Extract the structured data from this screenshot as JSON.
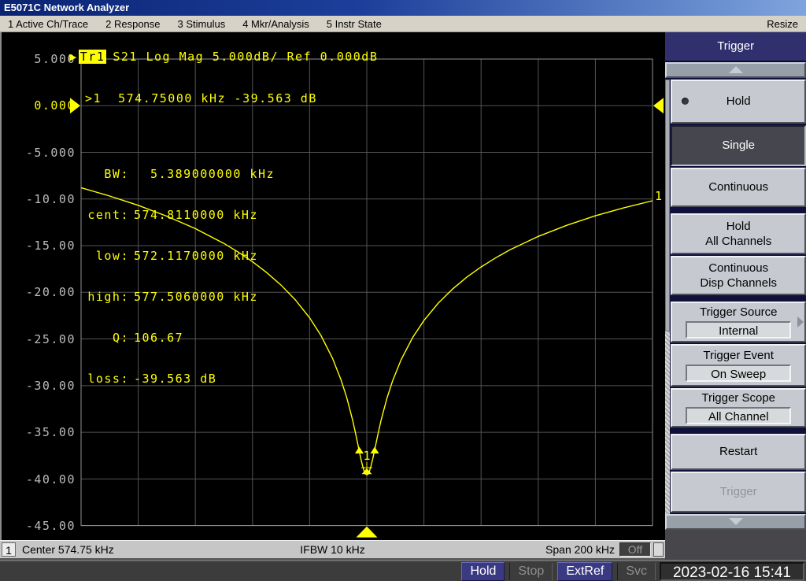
{
  "title_bar": {
    "title": "E5071C Network Analyzer"
  },
  "menu_bar": {
    "items": [
      "1 Active Ch/Trace",
      "2 Response",
      "3 Stimulus",
      "4 Mkr/Analysis",
      "5 Instr State"
    ],
    "resize": "Resize"
  },
  "trace_header": {
    "arrow": "▶",
    "trace": "Tr1",
    "text": "S21 Log Mag 5.000dB/ Ref 0.000dB"
  },
  "marker_readout": {
    "line1": ">1  574.75000 kHz -39.563 dB",
    "rows": [
      {
        "label": "BW:",
        "value": "  5.389000000 kHz"
      },
      {
        "label": "cent:",
        "value": "574.8110000 kHz"
      },
      {
        "label": "low:",
        "value": "572.1170000 kHz"
      },
      {
        "label": "high:",
        "value": "577.5060000 kHz"
      },
      {
        "label": "Q:",
        "value": "106.67"
      },
      {
        "label": "loss:",
        "value": "-39.563 dB"
      }
    ]
  },
  "axis": {
    "y_labels": [
      "5.000",
      "0.000",
      "-5.000",
      "-10.00",
      "-15.00",
      "-20.00",
      "-25.00",
      "-30.00",
      "-35.00",
      "-40.00",
      "-45.00"
    ]
  },
  "chart_data": {
    "type": "line",
    "title": "Tr1 S21 Log Mag 5.000dB/ Ref 0.000dB",
    "ylabel": "dB",
    "ylim": [
      -45,
      5
    ],
    "scale_db_per_div": 5,
    "ref_level_db": 0,
    "center_khz": 574.75,
    "x_span_khz": 200,
    "x_range_khz": [
      474.75,
      674.75
    ],
    "grid": true,
    "series": [
      {
        "name": "Tr1 S21",
        "trace_number": "1",
        "color": "#ffff00",
        "points": [
          [
            -100,
            -8.79
          ],
          [
            -90,
            -9.68
          ],
          [
            -80,
            -10.68
          ],
          [
            -70,
            -11.84
          ],
          [
            -60,
            -13.17
          ],
          [
            -50,
            -14.76
          ],
          [
            -45,
            -15.69
          ],
          [
            -40,
            -16.72
          ],
          [
            -35,
            -17.89
          ],
          [
            -30,
            -19.23
          ],
          [
            -25,
            -20.82
          ],
          [
            -20,
            -22.74
          ],
          [
            -16,
            -24.65
          ],
          [
            -12,
            -27.06
          ],
          [
            -9,
            -29.39
          ],
          [
            -7,
            -31.31
          ],
          [
            -5,
            -33.67
          ],
          [
            -4,
            -35.02
          ],
          [
            -3,
            -36.48
          ],
          [
            -2.5,
            -37.21
          ],
          [
            -2,
            -37.93
          ],
          [
            -1.5,
            -38.57
          ],
          [
            -1,
            -39.1
          ],
          [
            -0.5,
            -39.46
          ],
          [
            0,
            -39.563
          ],
          [
            0.5,
            -39.47
          ],
          [
            1,
            -39.12
          ],
          [
            1.5,
            -38.59
          ],
          [
            2,
            -37.95
          ],
          [
            2.5,
            -37.25
          ],
          [
            3,
            -36.52
          ],
          [
            4,
            -35.08
          ],
          [
            5,
            -33.74
          ],
          [
            7,
            -31.41
          ],
          [
            9,
            -29.51
          ],
          [
            12,
            -27.22
          ],
          [
            16,
            -24.87
          ],
          [
            20,
            -23.02
          ],
          [
            25,
            -21.16
          ],
          [
            30,
            -19.65
          ],
          [
            35,
            -18.38
          ],
          [
            40,
            -17.28
          ],
          [
            45,
            -16.32
          ],
          [
            50,
            -15.46
          ],
          [
            60,
            -14.01
          ],
          [
            70,
            -12.82
          ],
          [
            80,
            -11.8
          ],
          [
            90,
            -10.94
          ],
          [
            100,
            -10.19
          ]
        ]
      }
    ],
    "markers": {
      "marker1_number": "1",
      "marker1_freq_khz": 574.75,
      "marker1_offset_khz": 0,
      "marker1_db": -39.563,
      "bandwidth_khz": 5.389,
      "bandwidth_offsets_khz": [
        -2.633,
        2.756
      ],
      "bandwidth_level_db": -36.6,
      "q": 106.67,
      "loss_db": -39.563
    }
  },
  "sidebar": {
    "header": "Trigger",
    "buttons": [
      {
        "label": "Hold"
      },
      {
        "label": "Single"
      },
      {
        "label": "Continuous"
      },
      {
        "line1": "Hold",
        "line2": "All Channels"
      },
      {
        "line1": "Continuous",
        "line2": "Disp Channels"
      },
      {
        "label": "Trigger Source",
        "value": "Internal"
      },
      {
        "label": "Trigger Event",
        "value": "On Sweep"
      },
      {
        "label": "Trigger Scope",
        "value": "All Channel"
      },
      {
        "label": "Restart"
      },
      {
        "label": "Trigger"
      }
    ]
  },
  "channel_bar": {
    "channel": "1",
    "center": "Center 574.75 kHz",
    "ifbw": "IFBW 10 kHz",
    "span": "Span 200 kHz",
    "sweep_indicator": "Off"
  },
  "status_bar": {
    "hold": "Hold",
    "stop": "Stop",
    "extref": "ExtRef",
    "svc": "Svc",
    "datetime": "2023-02-16 15:41"
  },
  "colors": {
    "trace": "#ffff00",
    "grid": "#545454",
    "grid_border": "#8f8f8f",
    "status_badge": "#3a3a82",
    "sidebar_header": "#30306e"
  }
}
